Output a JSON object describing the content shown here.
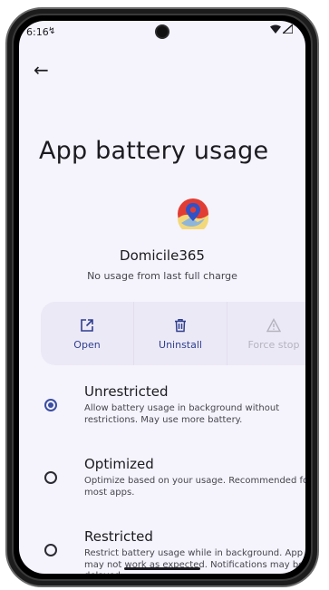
{
  "status": {
    "time": "6:16",
    "time_icon": "sim-icon"
  },
  "header": {
    "back_label": "←",
    "title": "App battery usage"
  },
  "app": {
    "name": "Domicile365",
    "usage_text": "No usage from last full charge"
  },
  "actions": [
    {
      "label": "Open",
      "icon": "open-external-icon",
      "enabled": true
    },
    {
      "label": "Uninstall",
      "icon": "trash-icon",
      "enabled": true
    },
    {
      "label": "Force stop",
      "icon": "warning-icon",
      "enabled": false
    }
  ],
  "options": [
    {
      "title": "Unrestricted",
      "description": "Allow battery usage in background without restrictions. May use more battery.",
      "selected": true
    },
    {
      "title": "Optimized",
      "description": "Optimize based on your usage. Recommended for most apps.",
      "selected": false
    },
    {
      "title": "Restricted",
      "description": "Restrict battery usage while in background. App may not work as expected. Notifications may be delayed.",
      "selected": false
    }
  ],
  "colors": {
    "accent": "#3a4ea3",
    "surface": "#f5f3fb",
    "action_bg": "#ece9f6"
  }
}
